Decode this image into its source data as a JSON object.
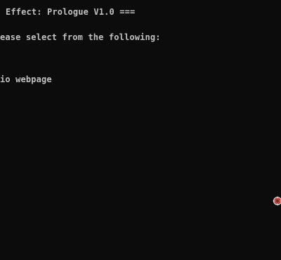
{
  "console": {
    "title_line": "Effect: Prologue V1.0 ===",
    "prompt_line": "ease select from the following:",
    "option_line": "io webpage"
  },
  "icons": {
    "cursor": "target-cursor-icon"
  },
  "colors": {
    "background": "#0c0c0c",
    "text": "#c0c0c0",
    "cursor_fill": "#b34a44"
  }
}
